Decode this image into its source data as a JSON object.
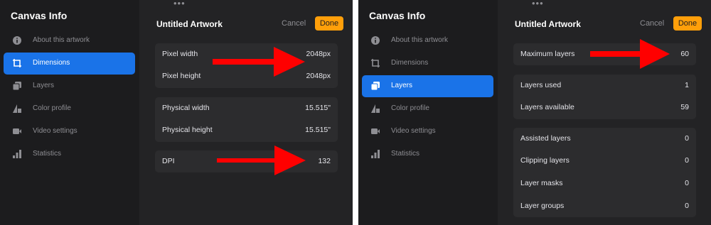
{
  "left": {
    "sidebar": {
      "title": "Canvas Info",
      "items": [
        {
          "label": "About this artwork",
          "icon": "info-icon"
        },
        {
          "label": "Dimensions",
          "icon": "crop-icon"
        },
        {
          "label": "Layers",
          "icon": "layers-icon"
        },
        {
          "label": "Color profile",
          "icon": "color-profile-icon"
        },
        {
          "label": "Video settings",
          "icon": "video-icon"
        },
        {
          "label": "Statistics",
          "icon": "bar-chart-icon"
        }
      ],
      "active_index": 1
    },
    "header": {
      "title": "Untitled Artwork",
      "cancel_label": "Cancel",
      "done_label": "Done"
    },
    "rows": [
      {
        "label": "Pixel width",
        "value": "2048px"
      },
      {
        "label": "Pixel height",
        "value": "2048px"
      },
      {
        "label": "Physical width",
        "value": "15.515\""
      },
      {
        "label": "Physical height",
        "value": "15.515\""
      },
      {
        "label": "DPI",
        "value": "132"
      }
    ]
  },
  "right": {
    "sidebar": {
      "title": "Canvas Info",
      "items": [
        {
          "label": "About this artwork",
          "icon": "info-icon"
        },
        {
          "label": "Dimensions",
          "icon": "crop-icon"
        },
        {
          "label": "Layers",
          "icon": "layers-icon"
        },
        {
          "label": "Color profile",
          "icon": "color-profile-icon"
        },
        {
          "label": "Video settings",
          "icon": "video-icon"
        },
        {
          "label": "Statistics",
          "icon": "bar-chart-icon"
        }
      ],
      "active_index": 2
    },
    "header": {
      "title": "Untitled Artwork",
      "cancel_label": "Cancel",
      "done_label": "Done"
    },
    "rows": [
      {
        "label": "Maximum layers",
        "value": "60"
      },
      {
        "label": "Layers used",
        "value": "1"
      },
      {
        "label": "Layers available",
        "value": "59"
      },
      {
        "label": "Assisted layers",
        "value": "0"
      },
      {
        "label": "Clipping layers",
        "value": "0"
      },
      {
        "label": "Layer masks",
        "value": "0"
      },
      {
        "label": "Layer groups",
        "value": "0"
      }
    ]
  },
  "colors": {
    "accent": "#1a73e8",
    "done": "#ff9f0a",
    "arrow": "#ff0000",
    "background": "#1c1c1e"
  }
}
